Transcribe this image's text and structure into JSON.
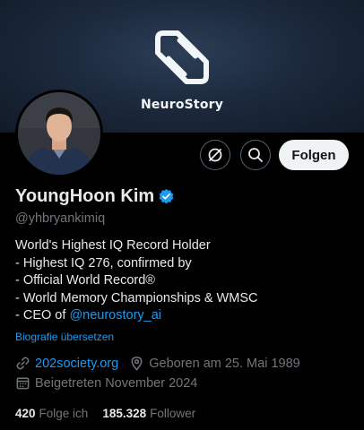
{
  "banner": {
    "brand": "NeuroStory",
    "logo_icon": "neurostory-logo-icon"
  },
  "header_actions": {
    "grok_icon": "grok-icon",
    "search_icon": "search-icon",
    "follow_label": "Folgen"
  },
  "profile": {
    "name": "YoungHoon Kim",
    "handle": "@yhbryankimiq",
    "verified_icon": "verified-badge-icon",
    "bio": {
      "line1": "World's Highest IQ Record Holder",
      "line2": "- Highest IQ 276, confirmed by",
      "line3": "- Official World Record®",
      "line4": "- World Memory Championships & WMSC",
      "line5_prefix": "- CEO of ",
      "line5_mention": "@neurostory_ai"
    },
    "translate_label": "Biografie übersetzen",
    "website": "202society.org",
    "birthday": "Geboren am 25. Mai 1989",
    "joined": "Beigetreten November 2024"
  },
  "stats": {
    "following_count": "420",
    "following_label": "Folge ich",
    "followers_count": "185.328",
    "followers_label": "Follower"
  },
  "colors": {
    "accent": "#1d9bf0",
    "background": "#000000",
    "muted": "#71767b"
  }
}
